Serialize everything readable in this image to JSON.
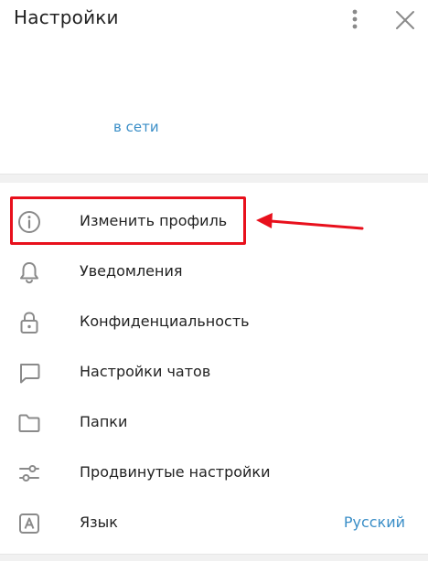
{
  "header": {
    "title": "Настройки"
  },
  "profile": {
    "status": "в сети"
  },
  "menu": {
    "items": [
      {
        "label": "Изменить профиль",
        "icon": "info-icon"
      },
      {
        "label": "Уведомления",
        "icon": "bell-icon"
      },
      {
        "label": "Конфиденциальность",
        "icon": "lock-icon"
      },
      {
        "label": "Настройки чатов",
        "icon": "chat-bubble-icon"
      },
      {
        "label": "Папки",
        "icon": "folder-icon"
      },
      {
        "label": "Продвинутые настройки",
        "icon": "sliders-icon"
      },
      {
        "label": "Язык",
        "icon": "language-icon",
        "value": "Русский"
      }
    ]
  },
  "colors": {
    "accent": "#3a8ec7",
    "icon": "#8a8a8a",
    "annotation": "#e8101c"
  }
}
